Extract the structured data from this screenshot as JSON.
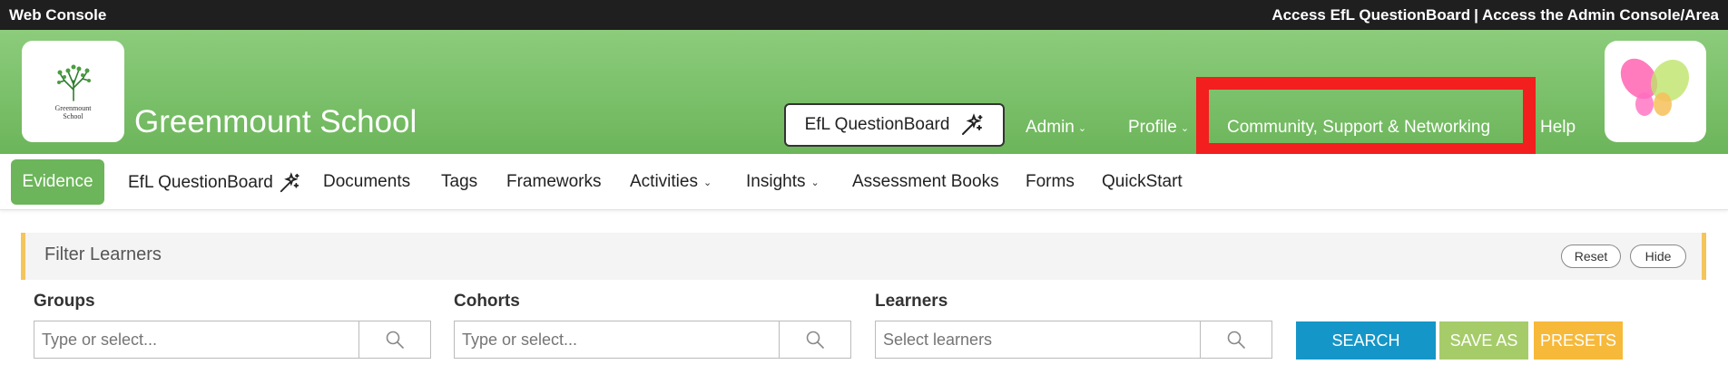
{
  "topbar": {
    "title": "Web Console",
    "link_questionboard": "Access EfL QuestionBoard",
    "separator": "|",
    "link_admin": "Access the Admin Console/Area"
  },
  "header": {
    "logo_line1": "Greenmount",
    "logo_line2": "School",
    "school_name": "Greenmount School",
    "questionboard_button": "EfL QuestionBoard",
    "nav": {
      "admin": "Admin",
      "profile": "Profile",
      "community": "Community, Support & Networking",
      "help": "Help"
    }
  },
  "subnav": {
    "evidence": "Evidence",
    "questionboard": "EfL QuestionBoard",
    "documents": "Documents",
    "tags": "Tags",
    "frameworks": "Frameworks",
    "activities": "Activities",
    "insights": "Insights",
    "assessment_books": "Assessment Books",
    "forms": "Forms",
    "quickstart": "QuickStart"
  },
  "filter": {
    "title": "Filter Learners",
    "reset": "Reset",
    "hide": "Hide",
    "groups": {
      "label": "Groups",
      "placeholder": "Type or select..."
    },
    "cohorts": {
      "label": "Cohorts",
      "placeholder": "Type or select..."
    },
    "learners": {
      "label": "Learners",
      "placeholder": "Select learners"
    },
    "search_button": "SEARCH",
    "saveas_button": "SAVE AS",
    "presets_button": "PRESETS"
  },
  "colors": {
    "header_green": "#6cb55a",
    "highlight_red": "#f31e1e",
    "search_blue": "#1596c8",
    "saveas_green": "#a6cc6a",
    "presets_orange": "#f7b93a",
    "filter_accent": "#f3c55a"
  }
}
